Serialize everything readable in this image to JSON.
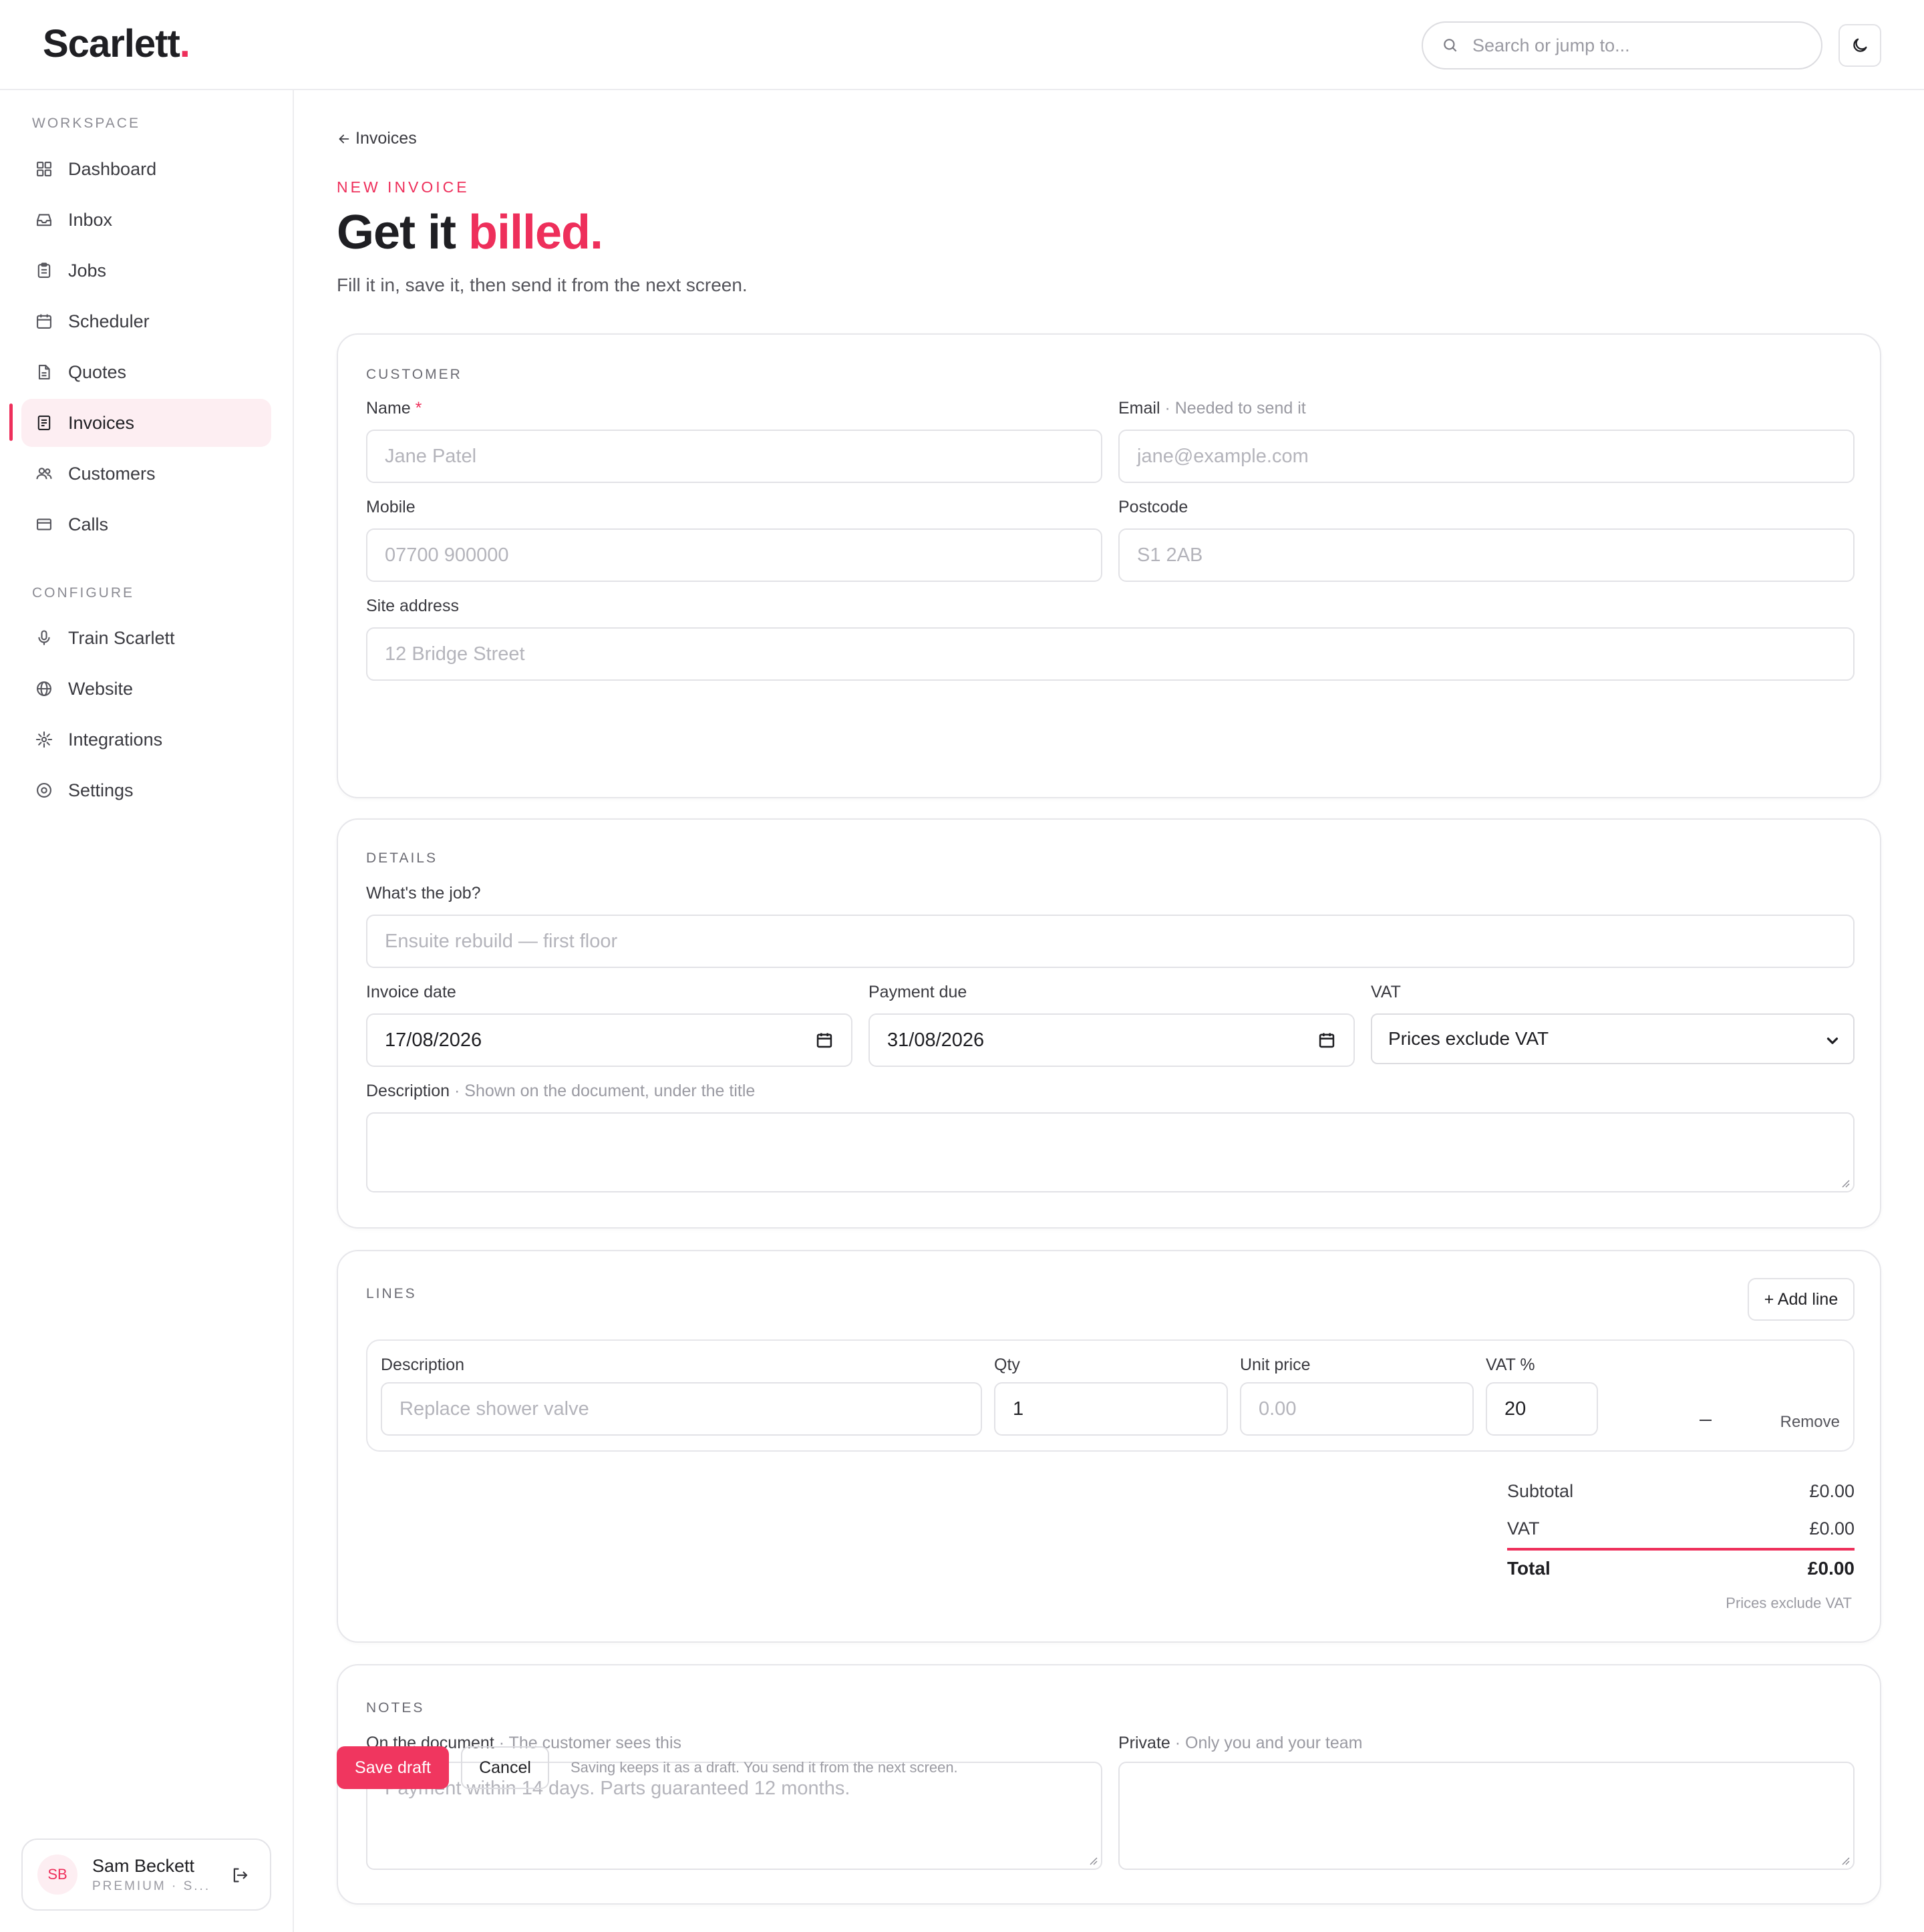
{
  "app": {
    "logo": "Scarlett",
    "logo_dot": ".",
    "search_placeholder": "Search or jump to..."
  },
  "sidebar": {
    "workspace_label": "WORKSPACE",
    "configure_label": "CONFIGURE",
    "workspace_items": [
      {
        "label": "Dashboard",
        "icon": "grid-icon"
      },
      {
        "label": "Inbox",
        "icon": "inbox-icon"
      },
      {
        "label": "Jobs",
        "icon": "clipboard-icon"
      },
      {
        "label": "Scheduler",
        "icon": "calendar-icon"
      },
      {
        "label": "Quotes",
        "icon": "document-icon"
      },
      {
        "label": "Invoices",
        "icon": "receipt-icon",
        "active": true
      },
      {
        "label": "Customers",
        "icon": "users-icon"
      },
      {
        "label": "Calls",
        "icon": "phone-card-icon"
      }
    ],
    "configure_items": [
      {
        "label": "Train Scarlett",
        "icon": "microphone-icon"
      },
      {
        "label": "Website",
        "icon": "globe-icon"
      },
      {
        "label": "Integrations",
        "icon": "sparkle-icon"
      },
      {
        "label": "Settings",
        "icon": "gear-icon"
      }
    ],
    "user": {
      "initials": "SB",
      "name": "Sam Beckett",
      "plan": "PREMIUM · S..."
    }
  },
  "page": {
    "back_label": "Invoices",
    "eyebrow": "NEW INVOICE",
    "headline_plain": "Get it ",
    "headline_accent": "billed.",
    "subtitle": "Fill it in, save it, then send it from the next screen."
  },
  "customer": {
    "section": "CUSTOMER",
    "name_label": "Name",
    "name_required": "*",
    "name_placeholder": "Jane Patel",
    "email_label": "Email",
    "email_hint": " · Needed to send it",
    "email_placeholder": "jane@example.com",
    "mobile_label": "Mobile",
    "mobile_placeholder": "07700 900000",
    "postcode_label": "Postcode",
    "postcode_placeholder": "S1 2AB",
    "address_label": "Site address",
    "address_placeholder": "12 Bridge Street"
  },
  "details": {
    "section": "DETAILS",
    "job_label": "What's the job?",
    "job_placeholder": "Ensuite rebuild — first floor",
    "invoice_date_label": "Invoice date",
    "invoice_date_value": "17/08/2026",
    "payment_due_label": "Payment due",
    "payment_due_value": "31/08/2026",
    "vat_label": "VAT",
    "vat_value": "Prices exclude VAT",
    "description_label": "Description",
    "description_hint": " · Shown on the document, under the title"
  },
  "lines": {
    "section": "LINES",
    "add_label": "+ Add line",
    "desc_label": "Description",
    "desc_placeholder": "Replace shower valve",
    "qty_label": "Qty",
    "qty_value": "1",
    "unit_label": "Unit price",
    "unit_placeholder": "0.00",
    "vat_label": "VAT %",
    "vat_value": "20",
    "remove_label": "Remove",
    "subtotal_label": "Subtotal",
    "subtotal_value": "£0.00",
    "vat_total_label": "VAT",
    "vat_total_value": "£0.00",
    "total_label": "Total",
    "total_value": "£0.00",
    "note": "Prices exclude VAT"
  },
  "notes": {
    "section": "NOTES",
    "doc_label": "On the document",
    "doc_hint": " · The customer sees this",
    "doc_placeholder": "Payment within 14 days. Parts guaranteed 12 months.",
    "private_label": "Private",
    "private_hint": " · Only you and your team"
  },
  "footer": {
    "save_label": "Save draft",
    "cancel_label": "Cancel",
    "note": "Saving keeps it as a draft. You send it from the next screen."
  },
  "colors": {
    "accent": "#ee2f5b",
    "active_bg": "#fdeef2",
    "border": "#e6e6ea"
  }
}
